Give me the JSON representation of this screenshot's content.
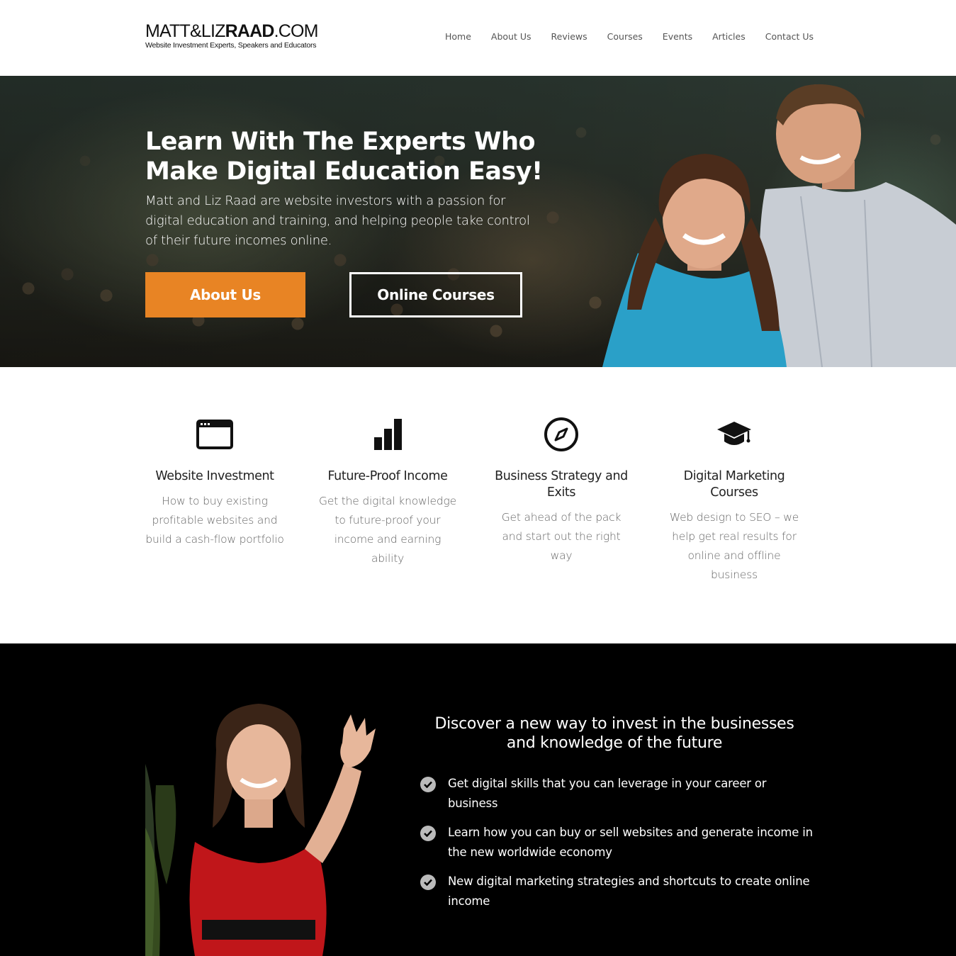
{
  "header": {
    "logo": {
      "prefix": "MATT&LIZ",
      "bold": "RAAD",
      "suffix": ".COM",
      "tagline": "Website Investment Experts, Speakers and Educators"
    },
    "nav": [
      "Home",
      "About Us",
      "Reviews",
      "Courses",
      "Events",
      "Articles",
      "Contact Us"
    ]
  },
  "hero": {
    "title_line1": "Learn With The Experts Who",
    "title_line2": "Make Digital Education Easy!",
    "subtitle": "Matt and Liz Raad are website investors with a passion for digital education and training, and helping people take control of their future incomes online.",
    "btn_primary": "About Us",
    "btn_secondary": "Online Courses"
  },
  "features": [
    {
      "icon": "browser-window-icon",
      "title": "Website Investment",
      "text": "How to buy existing profitable websites and build a cash-flow portfolio"
    },
    {
      "icon": "bar-chart-icon",
      "title": "Future-Proof Income",
      "text": "Get the digital knowledge to future-proof your income and earning ability"
    },
    {
      "icon": "compass-icon",
      "title": "Business Strategy and Exits",
      "text": "Get ahead of the pack and start out the right way"
    },
    {
      "icon": "graduation-cap-icon",
      "title": "Digital Marketing Courses",
      "text": "Web design to SEO – we help get real results for online and offline business"
    }
  ],
  "discover": {
    "title": "Discover a new way to invest in the businesses and knowledge of the future",
    "items": [
      "Get digital skills that you can leverage in your career or business",
      "Learn how you can buy or sell websites and generate income in the new worldwide economy",
      "New digital marketing strategies and shortcuts to create online income"
    ]
  },
  "colors": {
    "accent": "#e88424",
    "dark_bg": "#000000"
  }
}
